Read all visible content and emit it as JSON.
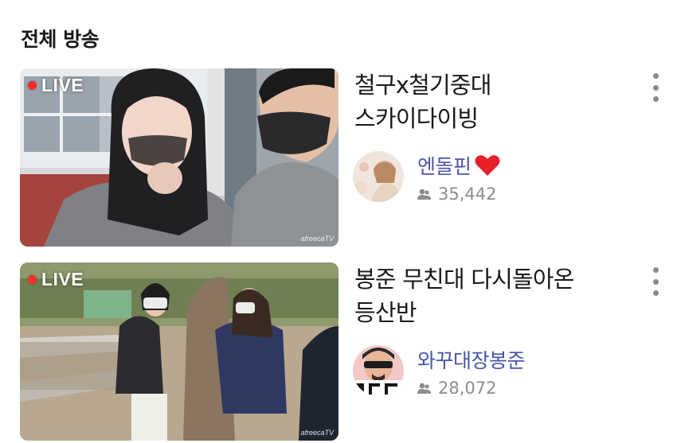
{
  "section": {
    "title": "전체 방송"
  },
  "broadcasts": [
    {
      "live_label": "LIVE",
      "watermark": "afreecaTV",
      "title": "철구x철기중대 스카이다이빙",
      "streamer": "엔돌핀",
      "viewers": "35,442"
    },
    {
      "live_label": "LIVE",
      "watermark": "afreecaTV",
      "title": "봉준 무친대 다시돌아온 등산반",
      "streamer": "와꾸대장봉준",
      "viewers": "28,072"
    }
  ],
  "colors": {
    "streamer_name": "#4a56a8",
    "live_dot": "#ff2b2b",
    "heart": "#e8202a"
  },
  "icons": {
    "more": "vertical-ellipsis-icon",
    "viewers": "person-icon",
    "live": "live-dot-icon",
    "heart": "heart-icon"
  }
}
